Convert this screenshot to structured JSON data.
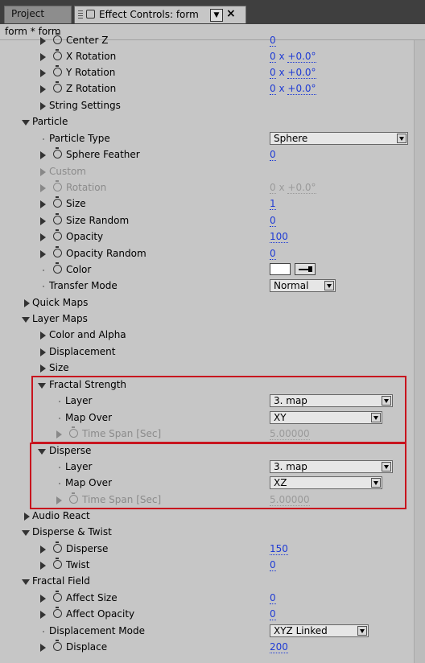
{
  "tabs": {
    "project_label": "Project",
    "effect_controls_label": "Effect Controls: form",
    "menu_arrow": "▼",
    "close_glyph": "×"
  },
  "breadcrumb": "form * form",
  "rows": [
    {
      "id": "r0",
      "label": "Center Z",
      "value": "0"
    },
    {
      "id": "r1",
      "label": "X Rotation",
      "rev": "0",
      "x": "x",
      "deg": "+0.0°"
    },
    {
      "id": "r2",
      "label": "Y Rotation",
      "rev": "0",
      "x": "x",
      "deg": "+0.0°"
    },
    {
      "id": "r3",
      "label": "Z Rotation",
      "rev": "0",
      "x": "x",
      "deg": "+0.0°"
    },
    {
      "id": "r4",
      "label": "String Settings"
    },
    {
      "id": "r5",
      "label": "Particle"
    },
    {
      "id": "r6",
      "label": "Particle Type",
      "dropdown": "Sphere"
    },
    {
      "id": "r7",
      "label": "Sphere Feather",
      "value": "0"
    },
    {
      "id": "r8",
      "label": "Custom"
    },
    {
      "id": "r9",
      "label": "Rotation",
      "rev": "0",
      "x": "x",
      "deg": "+0.0°"
    },
    {
      "id": "r10",
      "label": "Size",
      "value": "1"
    },
    {
      "id": "r11",
      "label": "Size Random",
      "value": "0"
    },
    {
      "id": "r12",
      "label": "Opacity",
      "value": "100"
    },
    {
      "id": "r13",
      "label": "Opacity Random",
      "value": "0"
    },
    {
      "id": "r14",
      "label": "Color"
    },
    {
      "id": "r15",
      "label": "Transfer Mode",
      "dropdown": "Normal"
    },
    {
      "id": "r16",
      "label": "Quick Maps"
    },
    {
      "id": "r17",
      "label": "Layer Maps"
    },
    {
      "id": "r18",
      "label": "Color and Alpha"
    },
    {
      "id": "r19",
      "label": "Displacement"
    },
    {
      "id": "r20",
      "label": "Size"
    },
    {
      "id": "r21",
      "label": "Fractal Strength"
    },
    {
      "id": "r22",
      "label": "Layer",
      "dropdown": "3. map"
    },
    {
      "id": "r23",
      "label": "Map Over",
      "dropdown": "XY"
    },
    {
      "id": "r24",
      "label": "Time Span [Sec]",
      "value": "5.00000"
    },
    {
      "id": "r25",
      "label": "Disperse"
    },
    {
      "id": "r26",
      "label": "Layer",
      "dropdown": "3. map"
    },
    {
      "id": "r27",
      "label": "Map Over",
      "dropdown": "XZ"
    },
    {
      "id": "r28",
      "label": "Time Span [Sec]",
      "value": "5.00000"
    },
    {
      "id": "r29",
      "label": "Audio React"
    },
    {
      "id": "r30",
      "label": "Disperse & Twist"
    },
    {
      "id": "r31",
      "label": "Disperse",
      "value": "150"
    },
    {
      "id": "r32",
      "label": "Twist",
      "value": "0"
    },
    {
      "id": "r33",
      "label": "Fractal Field"
    },
    {
      "id": "r34",
      "label": "Affect Size",
      "value": "0"
    },
    {
      "id": "r35",
      "label": "Affect Opacity",
      "value": "0"
    },
    {
      "id": "r36",
      "label": "Displacement Mode",
      "dropdown": "XYZ Linked"
    },
    {
      "id": "r37",
      "label": "Displace",
      "value": "200"
    }
  ],
  "colors": {
    "highlight_box": "#c8141e",
    "value_link": "#1f3bd4",
    "color_swatch": "#ffffff"
  }
}
